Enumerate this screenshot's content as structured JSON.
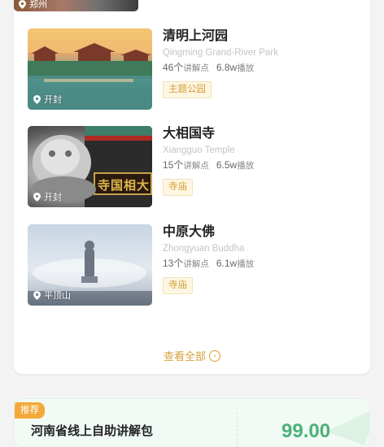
{
  "list": {
    "prev_item": {
      "location": "郑州"
    },
    "items": [
      {
        "title": "清明上河园",
        "subtitle": "Qingming Grand-River Park",
        "points": "46个",
        "points_unit": "讲解点",
        "plays": "6.8w",
        "plays_unit": "播放",
        "tag": "主题公园",
        "location": "开封"
      },
      {
        "title": "大相国寺",
        "subtitle": "Xiangguo Temple",
        "points": "15个",
        "points_unit": "讲解点",
        "plays": "6.5w",
        "plays_unit": "播放",
        "tag": "寺庙",
        "location": "开封",
        "plaque": "寺国相大"
      },
      {
        "title": "中原大佛",
        "subtitle": "Zhongyuan Buddha",
        "points": "13个",
        "points_unit": "讲解点",
        "plays": "6.1w",
        "plays_unit": "播放",
        "tag": "寺庙",
        "location": "平顶山"
      }
    ],
    "see_all_label": "查看全部"
  },
  "promo": {
    "badge": "推荐",
    "title": "河南省线上自助讲解包",
    "price": "99.00"
  },
  "colors": {
    "accent_gold": "#d5a13a",
    "tag_bg": "#fdf6e3",
    "price_green": "#4cb17a",
    "badge_orange": "#f4a83a"
  }
}
